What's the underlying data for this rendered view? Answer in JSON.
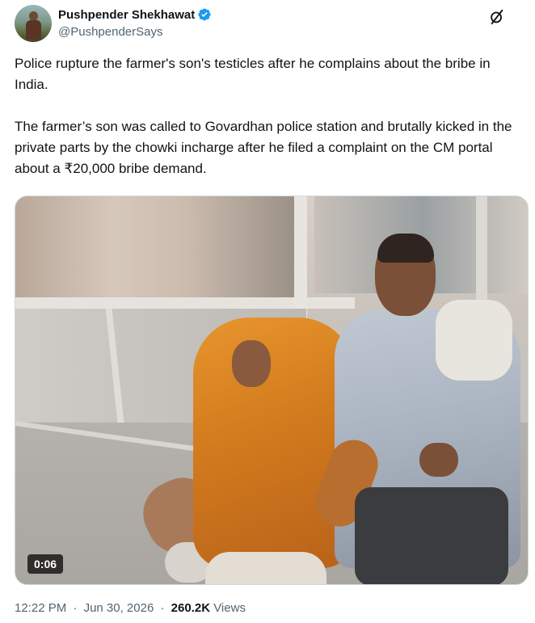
{
  "author": {
    "display_name": "Pushpender Shekhawat",
    "handle": "@PushpenderSays",
    "verified_color": "#1d9bf0"
  },
  "tweet": {
    "paragraphs": [
      "Police rupture the farmer's son's testicles after he complains about the bribe in India.",
      "The farmer’s son was called to Govardhan police station and brutally kicked in the private parts by the chowki incharge after he filed a complaint on the CM portal about a ₹20,000 bribe demand."
    ]
  },
  "media": {
    "type": "video",
    "duration": "0:06"
  },
  "meta": {
    "time": "12:22 PM",
    "date": "Jun 30, 2026",
    "separator": "·",
    "views_count": "260.2K",
    "views_label": "Views"
  },
  "icons": {
    "grok": "grok-icon",
    "verified": "verified-badge-icon"
  }
}
